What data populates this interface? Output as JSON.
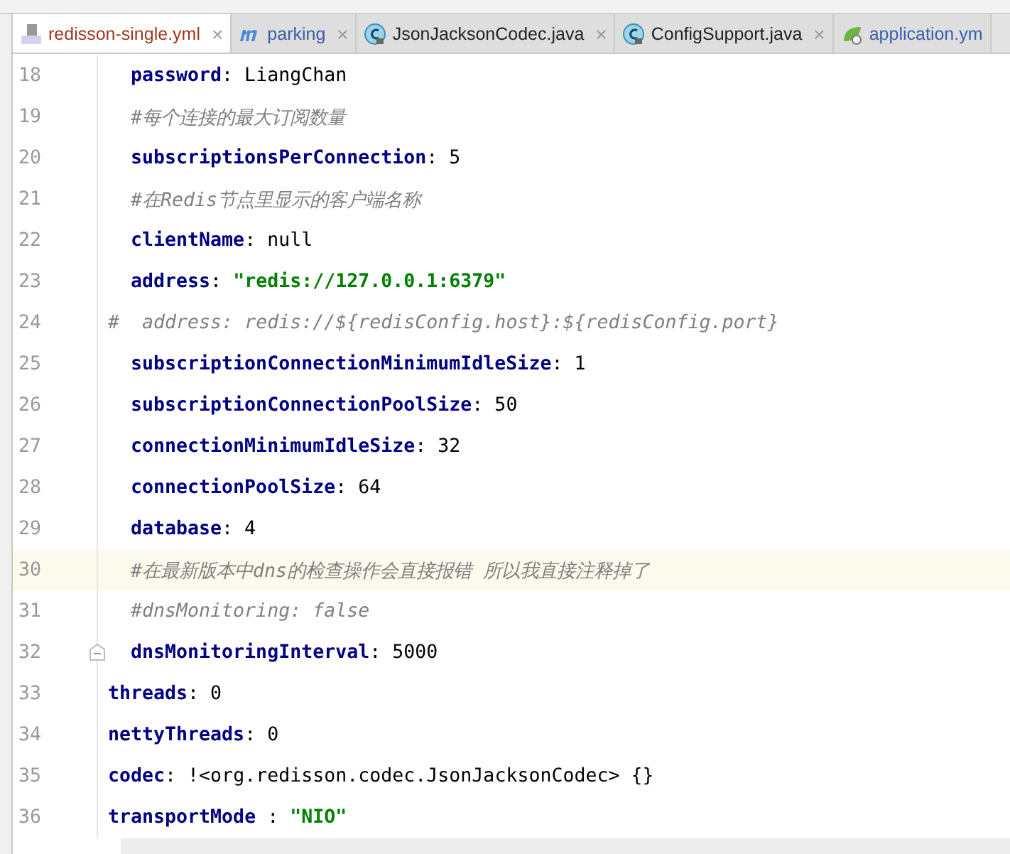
{
  "tabs": [
    {
      "label": "redisson-single.yml",
      "kind": "yml",
      "selected": true,
      "modified": true,
      "close": "×"
    },
    {
      "label": "parking",
      "kind": "module",
      "selected": false,
      "modified": false,
      "close": "×"
    },
    {
      "label": "JsonJacksonCodec.java",
      "kind": "class",
      "selected": false,
      "modified": false,
      "close": "×"
    },
    {
      "label": "ConfigSupport.java",
      "kind": "class",
      "selected": false,
      "modified": false,
      "close": "×"
    },
    {
      "label": "application.ym",
      "kind": "spring",
      "selected": false,
      "modified": false
    }
  ],
  "lines": [
    {
      "number": "18",
      "indented": true,
      "tokens": [
        {
          "kind": "key",
          "text": "password"
        },
        {
          "kind": "plain",
          "text": ": LiangChan"
        }
      ]
    },
    {
      "number": "19",
      "indented": true,
      "tokens": [
        {
          "kind": "comment",
          "text": "#每个连接的最大订阅数量"
        }
      ]
    },
    {
      "number": "20",
      "indented": true,
      "tokens": [
        {
          "kind": "key",
          "text": "subscriptionsPerConnection"
        },
        {
          "kind": "plain",
          "text": ": 5"
        }
      ]
    },
    {
      "number": "21",
      "indented": true,
      "tokens": [
        {
          "kind": "comment",
          "text": "#在Redis节点里显示的客户端名称"
        }
      ]
    },
    {
      "number": "22",
      "indented": true,
      "tokens": [
        {
          "kind": "key",
          "text": "clientName"
        },
        {
          "kind": "plain",
          "text": ": null"
        }
      ]
    },
    {
      "number": "23",
      "indented": true,
      "tokens": [
        {
          "kind": "key",
          "text": "address"
        },
        {
          "kind": "plain",
          "text": ": "
        },
        {
          "kind": "string",
          "text": "\"redis://127.0.0.1:6379\""
        }
      ]
    },
    {
      "number": "24",
      "indented": false,
      "tokens": [
        {
          "kind": "comment",
          "text": "#  address: redis://${redisConfig.host}:${redisConfig.port}"
        }
      ]
    },
    {
      "number": "25",
      "indented": true,
      "tokens": [
        {
          "kind": "key",
          "text": "subscriptionConnectionMinimumIdleSize"
        },
        {
          "kind": "plain",
          "text": ": 1"
        }
      ]
    },
    {
      "number": "26",
      "indented": true,
      "tokens": [
        {
          "kind": "key",
          "text": "subscriptionConnectionPoolSize"
        },
        {
          "kind": "plain",
          "text": ": 50"
        }
      ]
    },
    {
      "number": "27",
      "indented": true,
      "tokens": [
        {
          "kind": "key",
          "text": "connectionMinimumIdleSize"
        },
        {
          "kind": "plain",
          "text": ": 32"
        }
      ]
    },
    {
      "number": "28",
      "indented": true,
      "tokens": [
        {
          "kind": "key",
          "text": "connectionPoolSize"
        },
        {
          "kind": "plain",
          "text": ": 64"
        }
      ]
    },
    {
      "number": "29",
      "indented": true,
      "tokens": [
        {
          "kind": "key",
          "text": "database"
        },
        {
          "kind": "plain",
          "text": ": 4"
        }
      ]
    },
    {
      "number": "30",
      "indented": true,
      "current": true,
      "tokens": [
        {
          "kind": "comment",
          "text": "#在最新版本中dns的检查操作会直接报错 所以我直接注释掉了"
        }
      ]
    },
    {
      "number": "31",
      "indented": true,
      "tokens": [
        {
          "kind": "comment",
          "text": "#dnsMonitoring: false"
        }
      ]
    },
    {
      "number": "32",
      "indented": true,
      "fold": true,
      "tokens": [
        {
          "kind": "key",
          "text": "dnsMonitoringInterval"
        },
        {
          "kind": "plain",
          "text": ": 5000"
        }
      ]
    },
    {
      "number": "33",
      "indented": false,
      "tokens": [
        {
          "kind": "key",
          "text": "threads"
        },
        {
          "kind": "plain",
          "text": ": 0"
        }
      ]
    },
    {
      "number": "34",
      "indented": false,
      "tokens": [
        {
          "kind": "key",
          "text": "nettyThreads"
        },
        {
          "kind": "plain",
          "text": ": 0"
        }
      ]
    },
    {
      "number": "35",
      "indented": false,
      "tokens": [
        {
          "kind": "key",
          "text": "codec"
        },
        {
          "kind": "plain",
          "text": ": !<org.redisson.codec.JsonJacksonCodec> {}"
        }
      ]
    },
    {
      "number": "36",
      "indented": false,
      "tokens": [
        {
          "kind": "key",
          "text": "transportMode"
        },
        {
          "kind": "plain",
          "text": " : "
        },
        {
          "kind": "string",
          "text": "\"NIO\""
        }
      ]
    }
  ]
}
